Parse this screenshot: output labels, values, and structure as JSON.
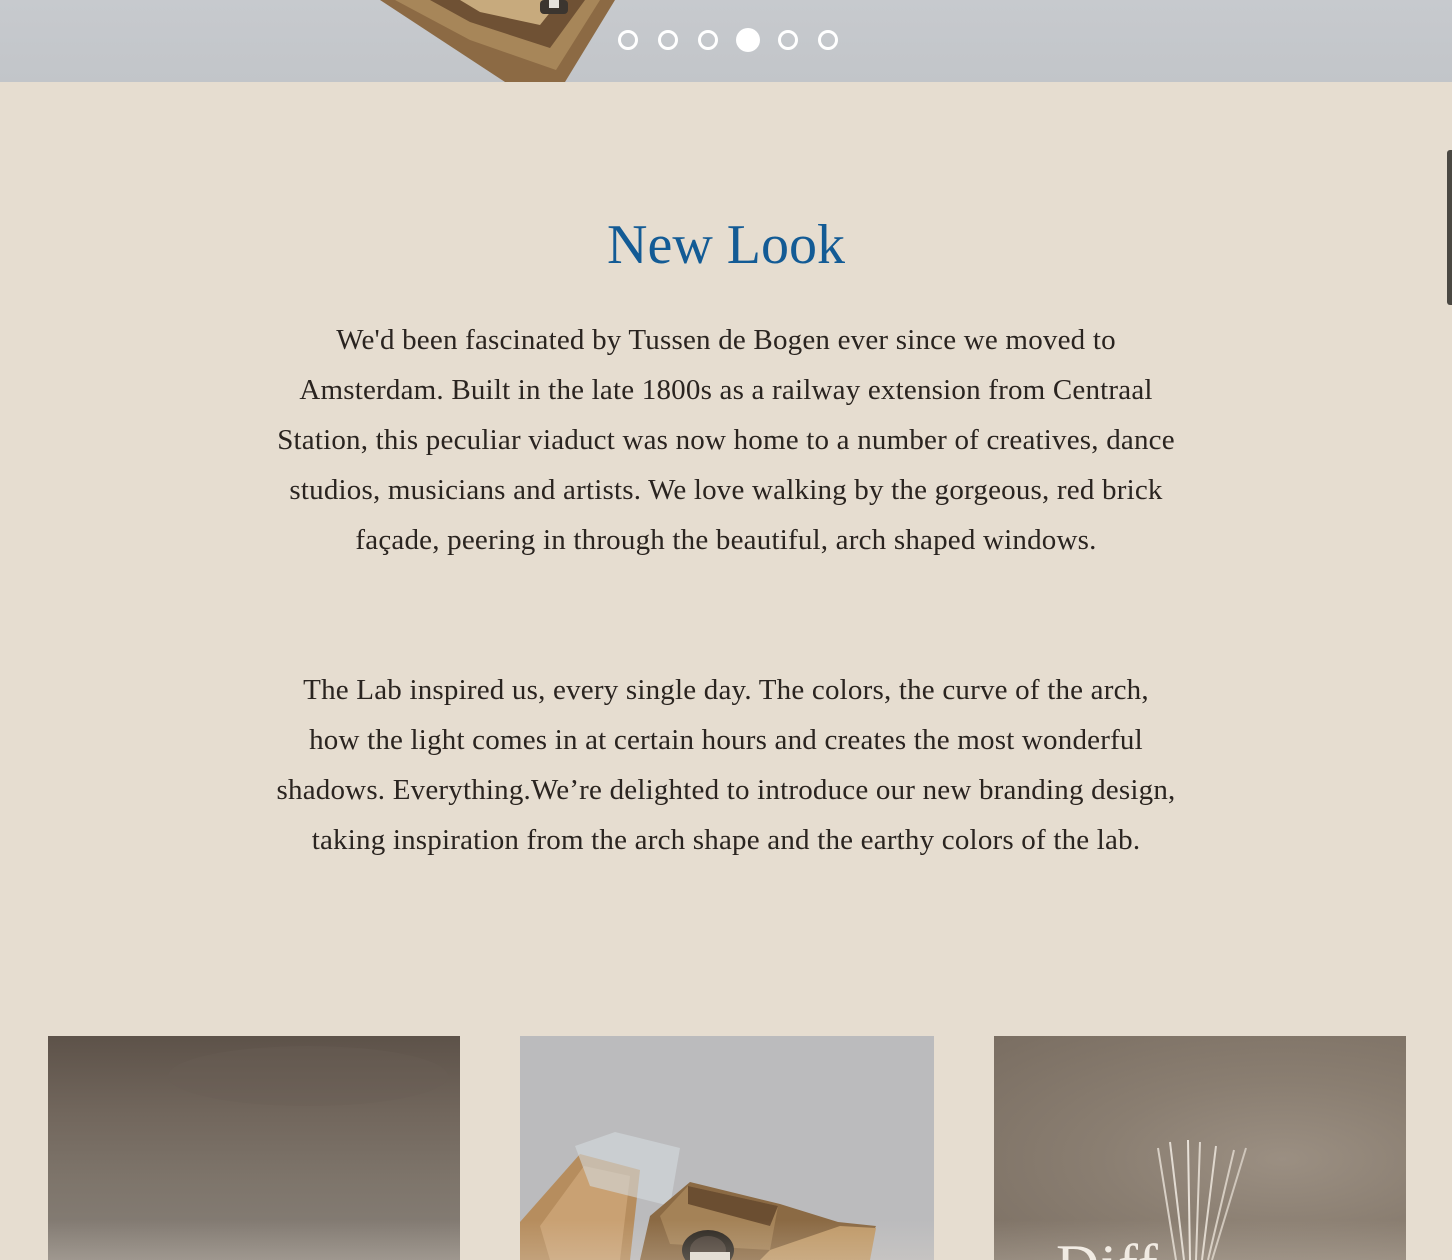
{
  "slider": {
    "slides": 6,
    "active_index": 3,
    "dots": [
      {
        "label": "Slide 1"
      },
      {
        "label": "Slide 2"
      },
      {
        "label": "Slide 3"
      },
      {
        "label": "Slide 4"
      },
      {
        "label": "Slide 5"
      },
      {
        "label": "Slide 6"
      }
    ]
  },
  "article": {
    "title": "New Look",
    "paragraphs": [
      "We'd been fascinated by Tussen de Bogen ever since we moved to Amsterdam. Built in the late 1800s as a railway extension from Centraal Station, this peculiar viaduct was now home to a number of creatives, dance studios, musicians and artists. We love walking by the gorgeous, red brick façade, peering in through the beautiful, arch shaped windows.",
      "The Lab inspired us, every single day. The colors, the curve of the arch, how the light comes in at certain hours and creates the most wonderful shadows. Everything.We’re delighted to introduce our new branding design, taking inspiration from the arch shape and the earthy colors of the lab."
    ]
  },
  "cards": [
    {
      "caption": ""
    },
    {
      "caption": ""
    },
    {
      "caption": "Diff"
    }
  ],
  "colors": {
    "background": "#e6ddd0",
    "title": "#135b95",
    "body_text": "#2a2420"
  }
}
